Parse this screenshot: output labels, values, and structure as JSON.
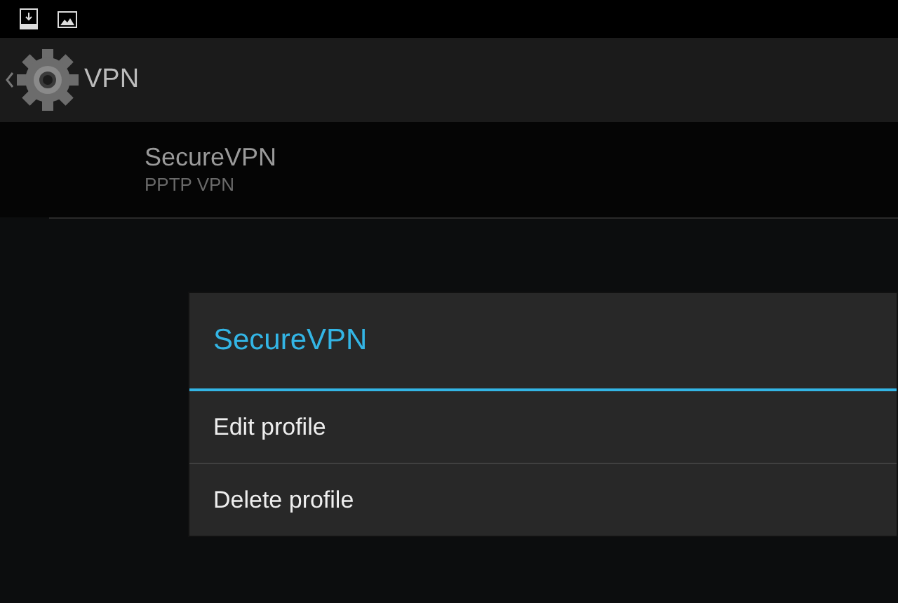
{
  "action_bar": {
    "title": "VPN"
  },
  "profiles": [
    {
      "name": "SecureVPN",
      "type": "PPTP VPN"
    }
  ],
  "dialog": {
    "title": "SecureVPN",
    "items": [
      {
        "label": "Edit profile"
      },
      {
        "label": "Delete profile"
      }
    ]
  }
}
